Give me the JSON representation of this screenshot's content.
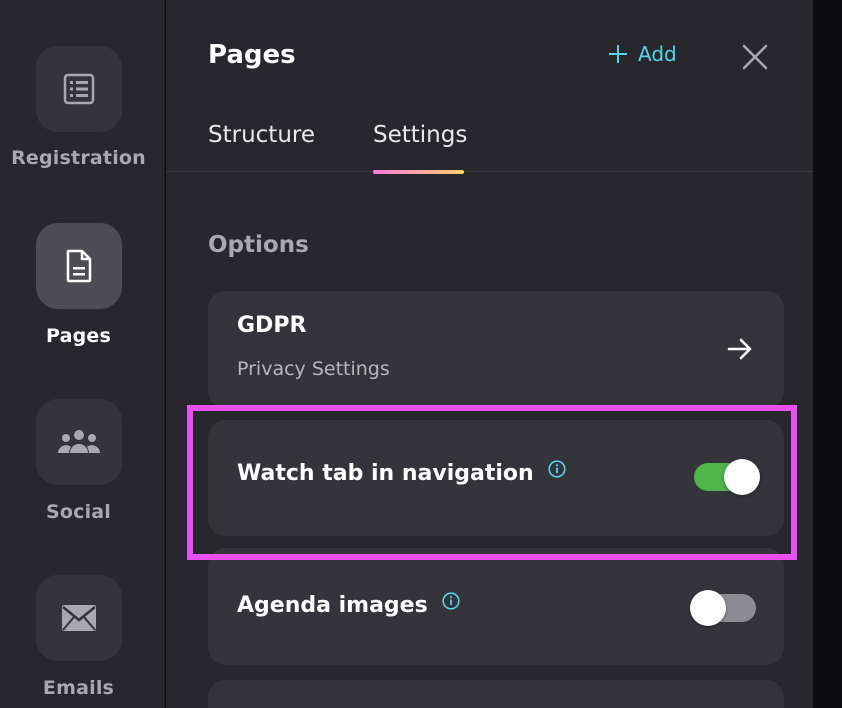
{
  "sidebar": {
    "items": [
      {
        "label": "Registration",
        "icon": "registration-form-icon",
        "active": false
      },
      {
        "label": "Pages",
        "icon": "page-document-icon",
        "active": true
      },
      {
        "label": "Social",
        "icon": "people-group-icon",
        "active": false
      },
      {
        "label": "Emails",
        "icon": "envelope-icon",
        "active": false
      }
    ]
  },
  "panel": {
    "title": "Pages",
    "add_label": "Add",
    "tabs": [
      {
        "label": "Structure",
        "active": false
      },
      {
        "label": "Settings",
        "active": true
      }
    ]
  },
  "options": {
    "section_title": "Options",
    "gdpr": {
      "title": "GDPR",
      "subtitle": "Privacy Settings"
    },
    "watch_tab": {
      "label": "Watch tab in navigation",
      "enabled": true
    },
    "agenda_images": {
      "label": "Agenda images",
      "enabled": false
    }
  },
  "colors": {
    "accent": "#56d4e8",
    "toggle_on": "#4fb44a",
    "toggle_off": "#8d8b95",
    "highlight": "#ea4ff2"
  }
}
